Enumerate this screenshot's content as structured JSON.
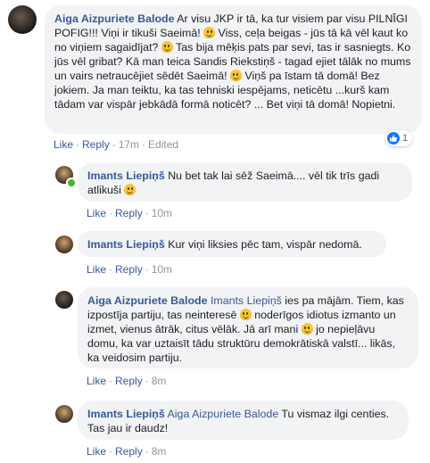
{
  "comments": [
    {
      "author": "Aiga Aizpuriete Balode",
      "text_parts": [
        "Ar visu JKP ir tā, ka tur visiem par visu PILNĪGI POFIG!!! Viņi ir tikuši Saeimā! ",
        " Viss, ceļa beigas - jūs tā kā vēl kaut ko no viņiem sagaidījat? ",
        " Tas bija mēķis pats par sevi, tas ir sasniegts. Ko jūs vēl gribat? Kā man teica Sandis Riekstiņš - tagad ejiet tālāk no mums un vairs netraucējiet sēdēt Saeimā! ",
        " Viņš pa īstam tā domā! Bez jokiem. Ja man teiktu, ka tas tehniski iespējams, neticētu ...kurš kam tādam var vispār jebkādā formā noticēt? ... Bet viņi tā domā! Nopietni."
      ],
      "like": "Like",
      "reply": "Reply",
      "time": "17m",
      "edited": "Edited",
      "reaction_count": "1"
    },
    {
      "author": "Imants Liepiņš",
      "text_parts": [
        "Nu bet tak lai sēž Saeimā.... vēl tik trīs gadi atlikuši "
      ],
      "like": "Like",
      "reply": "Reply",
      "time": "10m"
    },
    {
      "author": "Imants Liepiņš",
      "text_parts": [
        "Kur viņi liksies pēc tam, vispār nedomā."
      ],
      "like": "Like",
      "reply": "Reply",
      "time": "10m"
    },
    {
      "author": "Aiga Aizpuriete Balode",
      "tag": "Imants Liepiņš",
      "text_parts": [
        " ies pa mājām. Tiem, kas izpostīja partiju, tas neinteresē ",
        " noderīgos idiotus izmanto un izmet, vienus ātrāk, citus vēlāk. Jā arī mani ",
        " jo nepieļāvu domu, ka var uztaisīt tādu struktūru demokrātiskā valstī... likās, ka veidosim partiju."
      ],
      "like": "Like",
      "reply": "Reply",
      "time": "8m"
    },
    {
      "author": "Imants Liepiņš",
      "tag": "Aiga Aizpuriete Balode",
      "text_parts": [
        " Tu vismaz ilgi centies. Tas jau ir daudz!"
      ],
      "like": "Like",
      "reply": "Reply",
      "time": "8m"
    }
  ],
  "dot": "·",
  "colors": {
    "link": "#385898",
    "bubble": "#f2f3f5",
    "meta": "#90949c",
    "online": "#42b72a",
    "like_blue": "#1877f2"
  }
}
